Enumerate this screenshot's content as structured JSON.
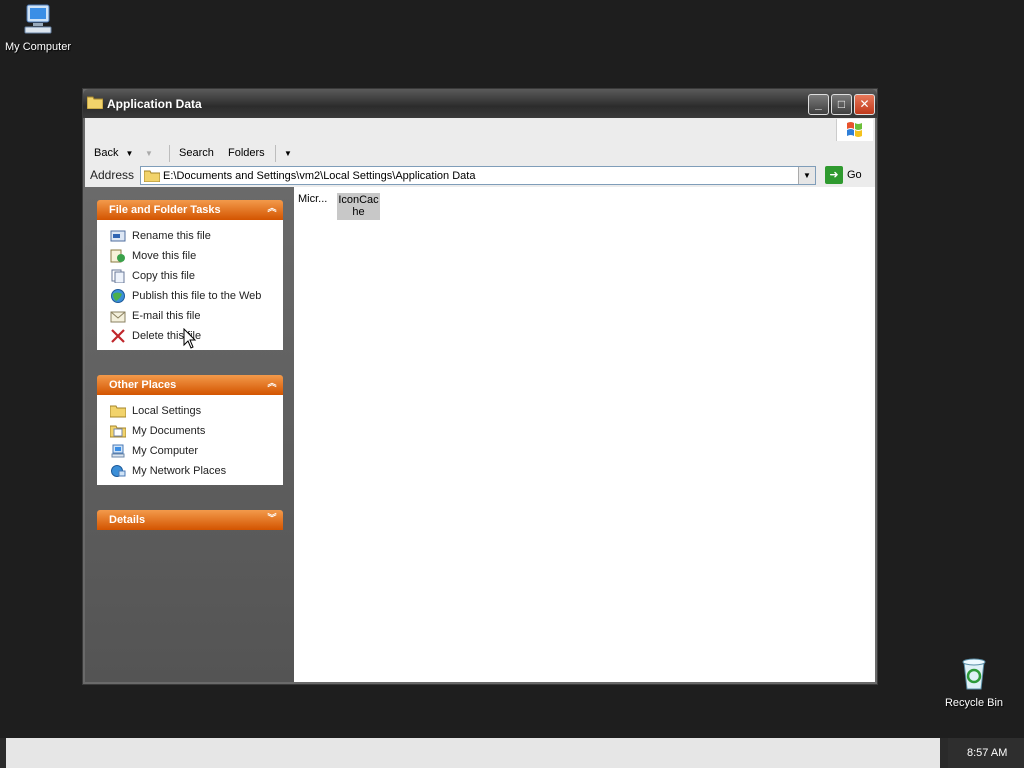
{
  "desktop": {
    "icons": [
      {
        "label": "My Computer",
        "icon": "computer-icon"
      },
      {
        "label": "Recycle Bin",
        "icon": "recycle-bin-icon"
      }
    ]
  },
  "window": {
    "title": "Application Data",
    "controls": {
      "minimize": "_",
      "maximize": "□",
      "close": "✕"
    }
  },
  "toolbar": {
    "back": "Back",
    "search": "Search",
    "folders": "Folders"
  },
  "address": {
    "label": "Address",
    "value": "E:\\Documents and Settings\\vm2\\Local Settings\\Application Data",
    "go": "Go"
  },
  "left_pane": {
    "file_tasks": {
      "title": "File and Folder Tasks",
      "items": [
        {
          "label": "Rename this file",
          "icon": "rename-icon"
        },
        {
          "label": "Move this file",
          "icon": "move-icon"
        },
        {
          "label": "Copy this file",
          "icon": "copy-icon"
        },
        {
          "label": "Publish this file to the Web",
          "icon": "publish-web-icon"
        },
        {
          "label": "E-mail this file",
          "icon": "email-icon"
        },
        {
          "label": "Delete this file",
          "icon": "delete-icon"
        }
      ]
    },
    "other_places": {
      "title": "Other Places",
      "items": [
        {
          "label": "Local Settings",
          "icon": "folder-icon"
        },
        {
          "label": "My Documents",
          "icon": "my-documents-icon"
        },
        {
          "label": "My Computer",
          "icon": "computer-icon"
        },
        {
          "label": "My Network Places",
          "icon": "network-icon"
        }
      ]
    },
    "details": {
      "title": "Details"
    }
  },
  "files": [
    {
      "label": "Micr...",
      "selected": false
    },
    {
      "label": "IconCac he",
      "selected": true
    }
  ],
  "taskbar": {
    "clock": "8:57 AM"
  }
}
